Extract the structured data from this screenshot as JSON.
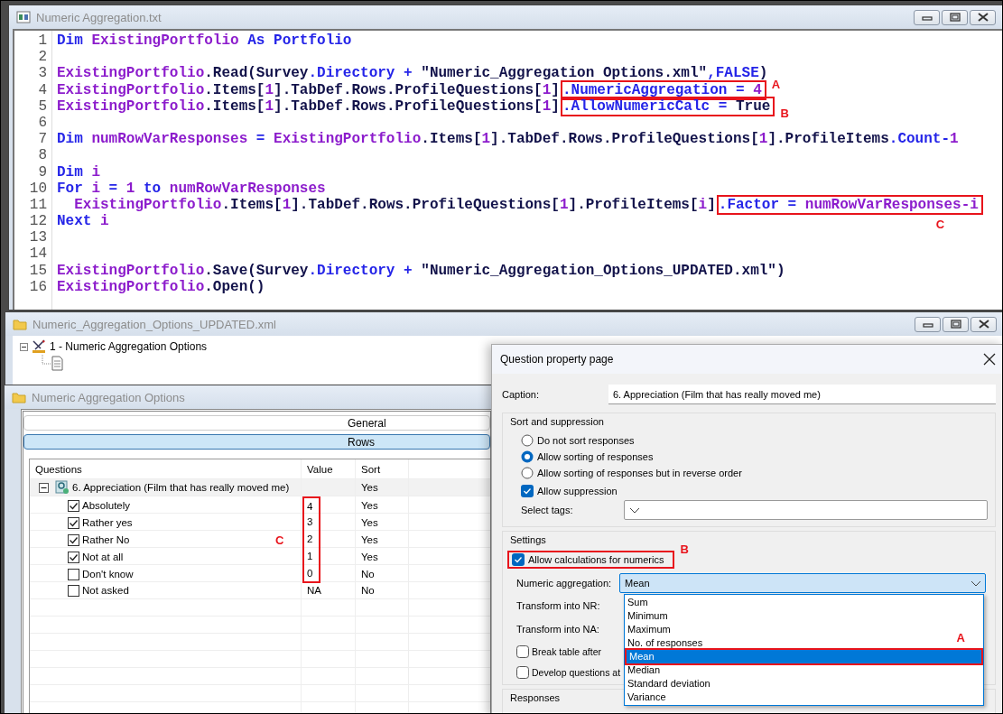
{
  "code_window": {
    "title": "Numeric Aggregation.txt",
    "lines": [
      {
        "number": "1",
        "tokens": [
          {
            "kind": "kw",
            "t": "Dim "
          },
          {
            "kind": "id",
            "t": "ExistingPortfolio "
          },
          {
            "kind": "kw",
            "t": "As Portfolio"
          }
        ]
      },
      {
        "number": "2"
      },
      {
        "number": "3",
        "tokens": [
          {
            "kind": "id",
            "t": "ExistingPortfolio"
          },
          {
            "kind": "tx",
            "t": ".Read(Survey"
          },
          {
            "kind": "kw",
            "t": ".Directory + "
          },
          {
            "kind": "tx",
            "t": "\"Numeric_Aggregation Options.xml\""
          },
          {
            "kind": "kw",
            "t": ",FALSE"
          },
          {
            "kind": "tx",
            "t": ")"
          }
        ]
      },
      {
        "number": "4",
        "tokens": [
          {
            "kind": "id",
            "t": "ExistingPortfolio"
          },
          {
            "kind": "tx",
            "t": ".Items["
          },
          {
            "kind": "nm",
            "t": "1"
          },
          {
            "kind": "tx",
            "t": "].TabDef.Rows.ProfileQuestions["
          },
          {
            "kind": "nm",
            "t": "1"
          },
          {
            "kind": "tx",
            "t": "]"
          }
        ],
        "highlight": {
          "label": "A",
          "tokens": [
            {
              "kind": "kw",
              "t": ".NumericAggregation = "
            },
            {
              "kind": "nm",
              "t": "4"
            }
          ]
        }
      },
      {
        "number": "5",
        "tokens": [
          {
            "kind": "id",
            "t": "ExistingPortfolio"
          },
          {
            "kind": "tx",
            "t": ".Items["
          },
          {
            "kind": "nm",
            "t": "1"
          },
          {
            "kind": "tx",
            "t": "].TabDef.Rows.ProfileQuestions["
          },
          {
            "kind": "nm",
            "t": "1"
          },
          {
            "kind": "tx",
            "t": "]"
          }
        ],
        "highlight": {
          "label": "B",
          "tokens": [
            {
              "kind": "kw",
              "t": ".AllowNumericCalc = "
            },
            {
              "kind": "tx",
              "t": "True"
            }
          ]
        }
      },
      {
        "number": "6"
      },
      {
        "number": "7",
        "tokens": [
          {
            "kind": "kw",
            "t": "Dim "
          },
          {
            "kind": "id",
            "t": "numRowVarResponses "
          },
          {
            "kind": "kw",
            "t": "= "
          },
          {
            "kind": "id",
            "t": "ExistingPortfolio"
          },
          {
            "kind": "tx",
            "t": ".Items["
          },
          {
            "kind": "nm",
            "t": "1"
          },
          {
            "kind": "tx",
            "t": "].TabDef.Rows.ProfileQuestions["
          },
          {
            "kind": "nm",
            "t": "1"
          },
          {
            "kind": "tx",
            "t": "].ProfileItems"
          },
          {
            "kind": "kw",
            "t": ".Count-"
          },
          {
            "kind": "nm",
            "t": "1"
          }
        ]
      },
      {
        "number": "8"
      },
      {
        "number": "9",
        "tokens": [
          {
            "kind": "kw",
            "t": "Dim "
          },
          {
            "kind": "id",
            "t": "i"
          }
        ]
      },
      {
        "number": "10",
        "tokens": [
          {
            "kind": "kw",
            "t": "For "
          },
          {
            "kind": "id",
            "t": "i "
          },
          {
            "kind": "kw",
            "t": "= "
          },
          {
            "kind": "nm",
            "t": "1 "
          },
          {
            "kind": "kw",
            "t": "to "
          },
          {
            "kind": "id",
            "t": "numRowVarResponses"
          }
        ]
      },
      {
        "number": "11",
        "tokens": [
          {
            "kind": "id",
            "t": "  ExistingPortfolio"
          },
          {
            "kind": "tx",
            "t": ".Items["
          },
          {
            "kind": "nm",
            "t": "1"
          },
          {
            "kind": "tx",
            "t": "].TabDef.Rows.ProfileQuestions["
          },
          {
            "kind": "nm",
            "t": "1"
          },
          {
            "kind": "tx",
            "t": "].ProfileItems["
          },
          {
            "kind": "nm",
            "t": "i"
          },
          {
            "kind": "tx",
            "t": "]"
          }
        ],
        "highlight": {
          "label": "C",
          "tokens": [
            {
              "kind": "kw",
              "t": ".Factor = "
            },
            {
              "kind": "id",
              "t": "numRowVarResponses-i"
            }
          ]
        }
      },
      {
        "number": "12",
        "tokens": [
          {
            "kind": "kw",
            "t": "Next "
          },
          {
            "kind": "id",
            "t": "i"
          }
        ]
      },
      {
        "number": "13"
      },
      {
        "number": "14"
      },
      {
        "number": "15",
        "tokens": [
          {
            "kind": "id",
            "t": "ExistingPortfolio"
          },
          {
            "kind": "tx",
            "t": ".Save(Survey"
          },
          {
            "kind": "kw",
            "t": ".Directory + "
          },
          {
            "kind": "tx",
            "t": "\"Numeric_Aggregation_Options_UPDATED.xml\")"
          }
        ]
      },
      {
        "number": "16",
        "tokens": [
          {
            "kind": "id",
            "t": "ExistingPortfolio"
          },
          {
            "kind": "tx",
            "t": ".Open()"
          }
        ]
      }
    ]
  },
  "tree_window": {
    "title": "Numeric_Aggregation_Options_UPDATED.xml",
    "items": [
      {
        "label": "1 - Numeric Aggregation Options",
        "expanded": true,
        "children": [
          {
            "kind": "document"
          }
        ]
      }
    ]
  },
  "options_window": {
    "title": "Numeric Aggregation Options",
    "tabs": [
      {
        "label": "General",
        "selected": false
      },
      {
        "label": "Rows",
        "selected": true
      }
    ],
    "table": {
      "columns": [
        "Questions",
        "Value",
        "Sort"
      ],
      "annotation": "C",
      "rows": [
        {
          "label": "6. Appreciation (Film that has really moved me)",
          "sort": "Yes",
          "expanded": true,
          "children": [
            {
              "label": "Absolutely",
              "checked": true,
              "value": "4",
              "sort": "Yes",
              "highlighted": true
            },
            {
              "label": "Rather yes",
              "checked": true,
              "value": "3",
              "sort": "Yes",
              "highlighted": true
            },
            {
              "label": "Rather No",
              "checked": true,
              "value": "2",
              "sort": "Yes",
              "highlighted": true
            },
            {
              "label": "Not at all",
              "checked": true,
              "value": "1",
              "sort": "Yes",
              "highlighted": true
            },
            {
              "label": "Don't know",
              "checked": false,
              "value": "0",
              "sort": "No",
              "highlighted": true
            },
            {
              "label": "Not asked",
              "checked": false,
              "value": "NA",
              "sort": "No",
              "highlighted": false
            }
          ]
        }
      ]
    }
  },
  "dialog": {
    "title": "Question property page",
    "caption": {
      "label": "Caption:",
      "value": "6. Appreciation (Film that has really moved me)"
    },
    "sort_group": {
      "title": "Sort and suppression",
      "options": [
        {
          "label": "Do not sort responses",
          "selected": false
        },
        {
          "label": "Allow sorting of responses",
          "selected": true
        },
        {
          "label": "Allow sorting of responses but in reverse order",
          "selected": false
        }
      ],
      "suppression": {
        "label": "Allow suppression",
        "checked": true
      },
      "tags": {
        "label": "Select tags:"
      }
    },
    "settings": {
      "title": "Settings",
      "allow_calc": {
        "label": "Allow calculations for numerics",
        "checked": true,
        "annotation": "B"
      },
      "aggregation": {
        "label": "Numeric aggregation:",
        "value": "Mean",
        "expanded": true,
        "options": [
          {
            "label": "Sum",
            "selected": false
          },
          {
            "label": "Minimum",
            "selected": false
          },
          {
            "label": "Maximum",
            "selected": false
          },
          {
            "label": "No. of responses",
            "selected": false
          },
          {
            "label": "Mean",
            "selected": true,
            "annotation": "A"
          },
          {
            "label": "Median",
            "selected": false
          },
          {
            "label": "Standard deviation",
            "selected": false
          },
          {
            "label": "Variance",
            "selected": false
          }
        ]
      },
      "transform_nr": {
        "label": "Transform into NR:"
      },
      "transform_na": {
        "label": "Transform into NA:"
      },
      "break_table": {
        "label": "Break table after",
        "checked": false
      },
      "develop": {
        "label": "Develop questions at",
        "checked": false
      }
    },
    "responses": {
      "title": "Responses"
    }
  }
}
